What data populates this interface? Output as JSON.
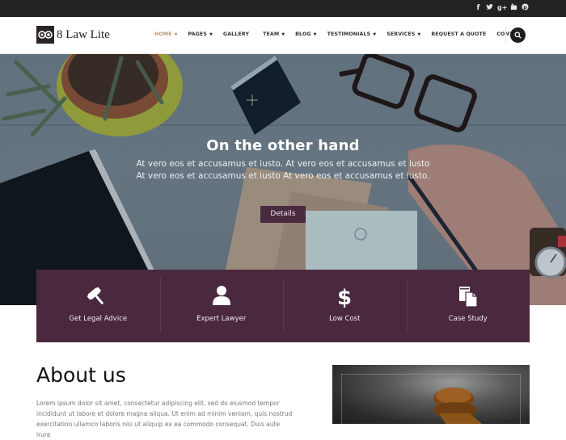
{
  "topbar": {
    "social_icons": [
      {
        "name": "facebook-icon",
        "glyph": "f"
      },
      {
        "name": "twitter-icon",
        "glyph": "t"
      },
      {
        "name": "google-plus-icon",
        "glyph": "g+"
      },
      {
        "name": "youtube-icon",
        "glyph": "▣"
      },
      {
        "name": "pinterest-icon",
        "glyph": "℗"
      }
    ]
  },
  "header": {
    "logo_text": "8 Law Lite",
    "nav": [
      {
        "label": "HOME",
        "dropdown": true,
        "active": true
      },
      {
        "label": "PAGES",
        "dropdown": true
      },
      {
        "label": "GALLERY",
        "dropdown": false
      },
      {
        "label": "TEAM",
        "dropdown": true
      },
      {
        "label": "BLOG",
        "dropdown": true
      },
      {
        "label": "TESTIMONIALS",
        "dropdown": true
      },
      {
        "label": "SERVICES",
        "dropdown": true
      },
      {
        "label": "REQUEST A QUOTE",
        "dropdown": false
      },
      {
        "label": "CONTACT",
        "dropdown": false
      }
    ],
    "caret": "▼",
    "search_icon": "search-icon"
  },
  "hero": {
    "title": "On the other hand",
    "text": "At vero eos et accusamus et iusto. At vero eos et accusamus et iusto At vero eos et accusamus et iusto At vero eos et accusamus et iusto.",
    "button_label": "Details"
  },
  "services": [
    {
      "label": "Get Legal Advice",
      "icon": "gavel-icon"
    },
    {
      "label": "Expert Lawyer",
      "icon": "user-icon"
    },
    {
      "label": "Low Cost",
      "icon": "dollar-icon"
    },
    {
      "label": "Case Study",
      "icon": "files-icon"
    }
  ],
  "about": {
    "title": "About us",
    "text": "Lorem ipsum dolor sit amet, consectetur adipiscing elit, sed do eiusmod tempor incididunt ut labore et dolore magna aliqua. Ut enim ad minim veniam, quis nostrud exercitation ullamco laboris nisi ut aliquip ex ea commodo consequat. Duis aute irure"
  },
  "colors": {
    "topbar": "#222222",
    "accent_gold": "#b99a6c",
    "brand_plum": "#4a283e",
    "text_dark": "#111111",
    "text_muted": "#777777"
  }
}
